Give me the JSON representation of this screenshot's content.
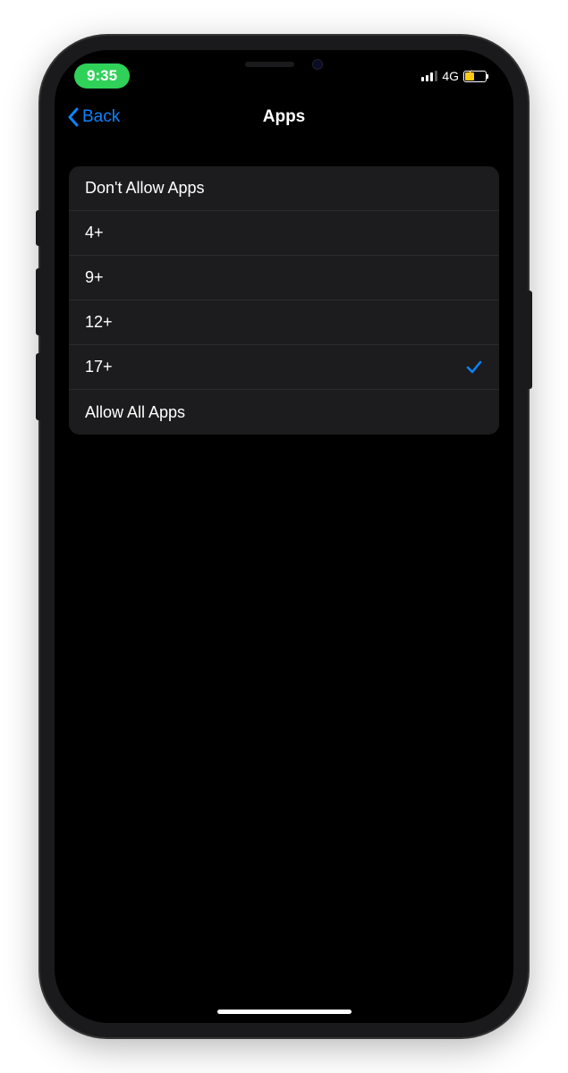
{
  "status_bar": {
    "time": "9:35",
    "network": "4G"
  },
  "nav": {
    "back_label": "Back",
    "title": "Apps"
  },
  "options": [
    {
      "label": "Don't Allow Apps",
      "selected": false
    },
    {
      "label": "4+",
      "selected": false
    },
    {
      "label": "9+",
      "selected": false
    },
    {
      "label": "12+",
      "selected": false
    },
    {
      "label": "17+",
      "selected": true
    },
    {
      "label": "Allow All Apps",
      "selected": false
    }
  ],
  "colors": {
    "accent": "#0a84ff",
    "pill": "#30d158",
    "battery_fill": "#ffcc00",
    "list_bg": "#1c1c1e"
  }
}
